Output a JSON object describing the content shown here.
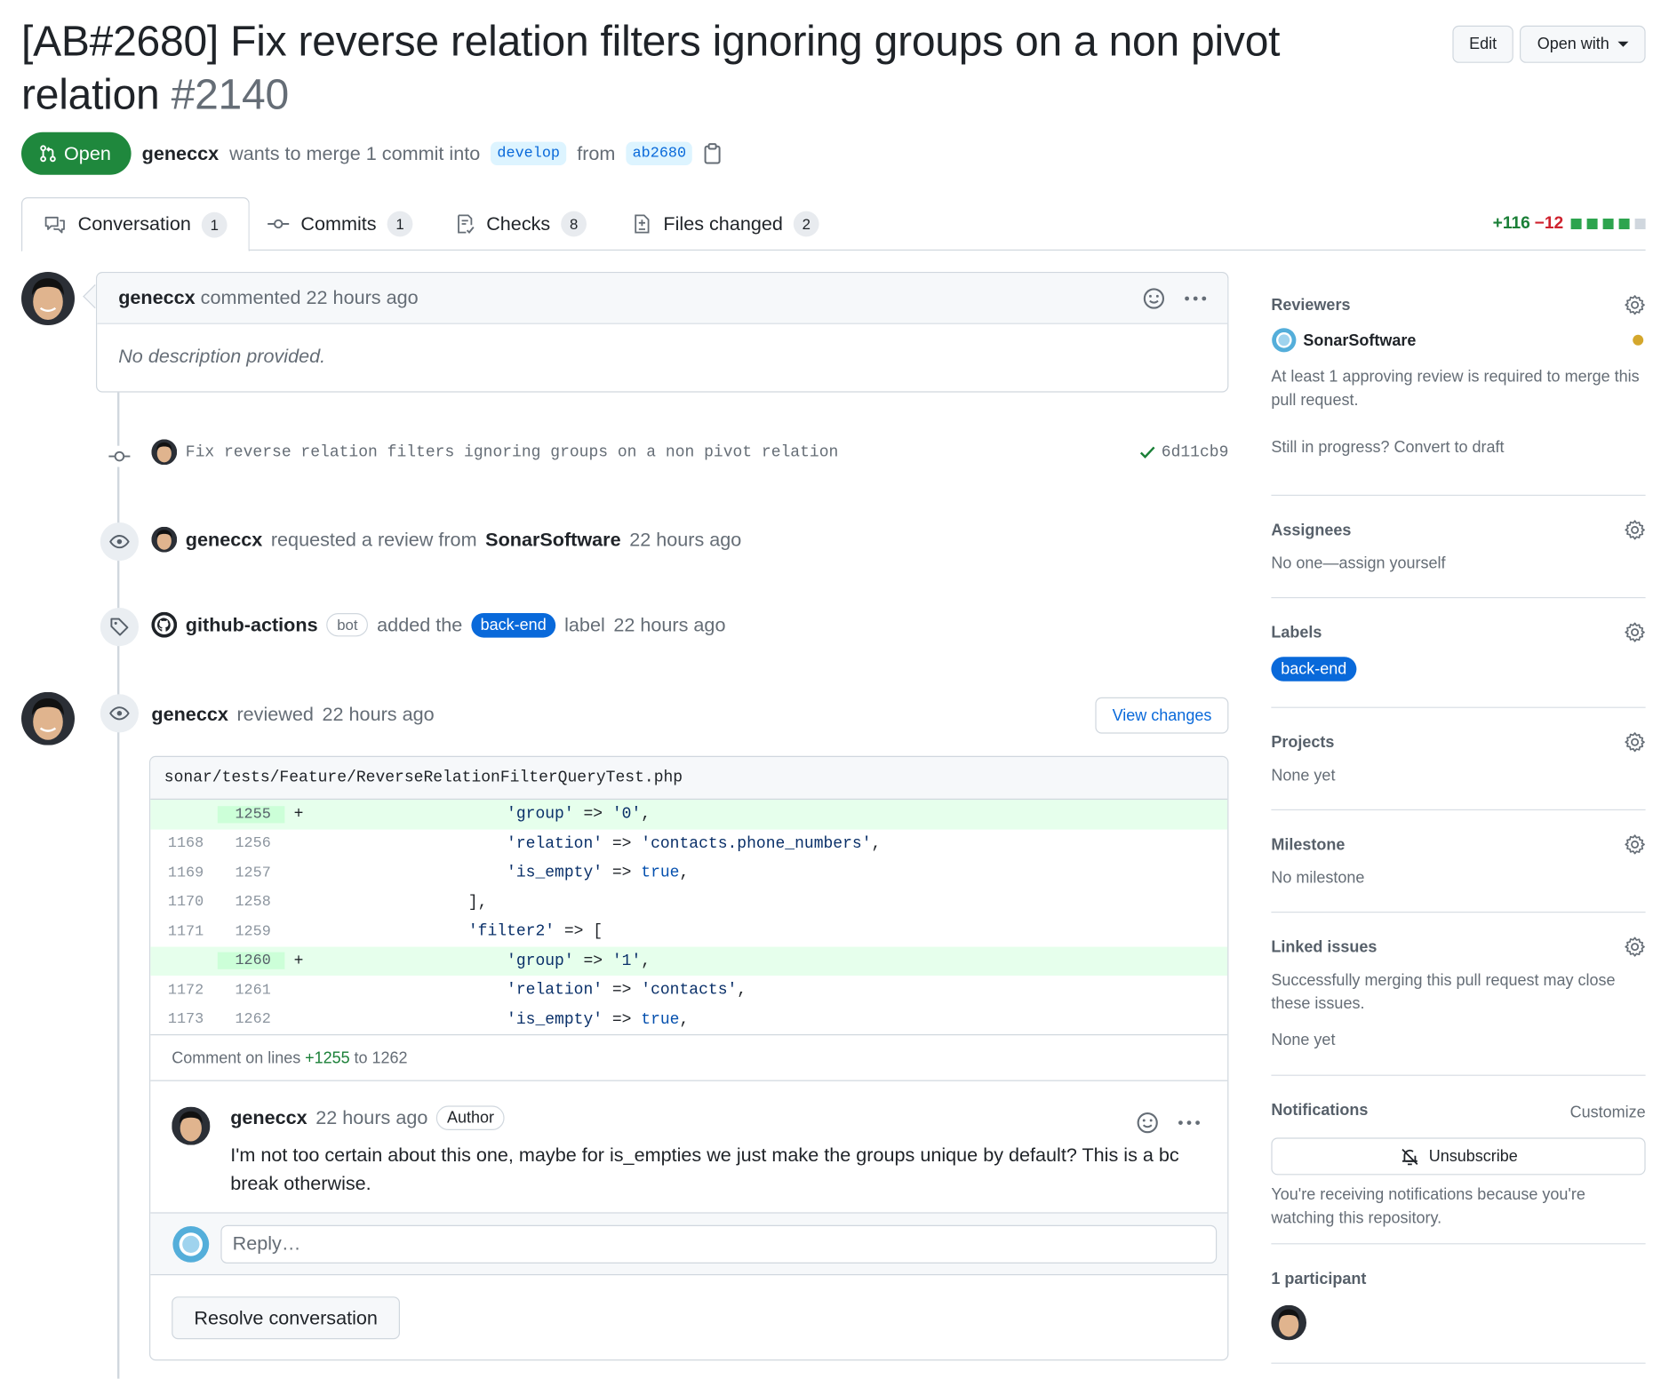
{
  "header": {
    "title": "[AB#2680] Fix reverse relation filters ignoring groups on a non pivot relation",
    "number": "#2140",
    "edit_label": "Edit",
    "open_with_label": "Open with"
  },
  "status": {
    "state_label": "Open",
    "author": "geneccx",
    "merge_text": "wants to merge 1 commit into",
    "base_branch": "develop",
    "from_text": "from",
    "head_branch": "ab2680"
  },
  "tabs": [
    {
      "label": "Conversation",
      "count": "1"
    },
    {
      "label": "Commits",
      "count": "1"
    },
    {
      "label": "Checks",
      "count": "8"
    },
    {
      "label": "Files changed",
      "count": "2"
    }
  ],
  "diffstat": {
    "additions": "+116",
    "deletions": "−12",
    "add_color": "#1a7f37",
    "del_color": "#cf222e"
  },
  "first_comment": {
    "author": "geneccx",
    "action": "commented",
    "time": "22 hours ago",
    "body": "No description provided."
  },
  "commit": {
    "message": "Fix reverse relation filters ignoring groups on a non pivot relation",
    "sha": "6d11cb9"
  },
  "review_request": {
    "actor": "geneccx",
    "text": "requested a review from",
    "reviewer": "SonarSoftware",
    "time": "22 hours ago"
  },
  "label_event": {
    "actor": "github-actions",
    "bot_label": "bot",
    "text": "added the",
    "label": "back-end",
    "label_word": "label",
    "time": "22 hours ago"
  },
  "review": {
    "author": "geneccx",
    "action": "reviewed",
    "time": "22 hours ago",
    "view_changes_label": "View changes",
    "file_path": "sonar/tests/Feature/ReverseRelationFilterQueryTest.php",
    "lines": [
      {
        "old": "",
        "new": "1255",
        "sign": "+",
        "type": "add",
        "indent": "                    ",
        "parts": [
          [
            "s",
            "'group'"
          ],
          [
            "p",
            " => "
          ],
          [
            "s",
            "'0'"
          ],
          [
            "p",
            ","
          ]
        ]
      },
      {
        "old": "1168",
        "new": "1256",
        "sign": "",
        "type": "ctx",
        "indent": "                    ",
        "parts": [
          [
            "s",
            "'relation'"
          ],
          [
            "p",
            " => "
          ],
          [
            "s",
            "'contacts.phone_numbers'"
          ],
          [
            "p",
            ","
          ]
        ]
      },
      {
        "old": "1169",
        "new": "1257",
        "sign": "",
        "type": "ctx",
        "indent": "                    ",
        "parts": [
          [
            "s",
            "'is_empty'"
          ],
          [
            "p",
            " => "
          ],
          [
            "k",
            "true"
          ],
          [
            "p",
            ","
          ]
        ]
      },
      {
        "old": "1170",
        "new": "1258",
        "sign": "",
        "type": "ctx",
        "indent": "                ",
        "parts": [
          [
            "p",
            "],"
          ]
        ]
      },
      {
        "old": "1171",
        "new": "1259",
        "sign": "",
        "type": "ctx",
        "indent": "                ",
        "parts": [
          [
            "s",
            "'filter2'"
          ],
          [
            "p",
            " => ["
          ]
        ]
      },
      {
        "old": "",
        "new": "1260",
        "sign": "+",
        "type": "add",
        "indent": "                    ",
        "parts": [
          [
            "s",
            "'group'"
          ],
          [
            "p",
            " => "
          ],
          [
            "s",
            "'1'"
          ],
          [
            "p",
            ","
          ]
        ]
      },
      {
        "old": "1172",
        "new": "1261",
        "sign": "",
        "type": "ctx",
        "indent": "                    ",
        "parts": [
          [
            "s",
            "'relation'"
          ],
          [
            "p",
            " => "
          ],
          [
            "s",
            "'contacts'"
          ],
          [
            "p",
            ","
          ]
        ]
      },
      {
        "old": "1173",
        "new": "1262",
        "sign": "",
        "type": "ctx",
        "indent": "                    ",
        "parts": [
          [
            "s",
            "'is_empty'"
          ],
          [
            "p",
            " => "
          ],
          [
            "k",
            "true"
          ],
          [
            "p",
            ","
          ]
        ]
      }
    ],
    "comment_on": "Comment on lines",
    "range_start": "+1255",
    "range_to": "to 1262",
    "reply_author": "geneccx",
    "reply_time": "22 hours ago",
    "reply_badge": "Author",
    "reply_body": "I'm not too certain about this one, maybe for is_empties we just make the groups unique by default? This is a bc break otherwise.",
    "reply_placeholder": "Reply…",
    "resolve_label": "Resolve conversation"
  },
  "sidebar": {
    "reviewers_title": "Reviewers",
    "reviewer_name": "SonarSoftware",
    "reviewer_status_color": "#d4a72c",
    "approval_text": "At least 1 approving review is required to merge this pull request.",
    "draft_text": "Still in progress? Convert to draft",
    "assignees_title": "Assignees",
    "assignees_text": "No one—assign yourself",
    "labels_title": "Labels",
    "label": "back-end",
    "projects_title": "Projects",
    "projects_text": "None yet",
    "milestone_title": "Milestone",
    "milestone_text": "No milestone",
    "linked_title": "Linked issues",
    "linked_text": "Successfully merging this pull request may close these issues.",
    "linked_none": "None yet",
    "notifications_title": "Notifications",
    "customize_label": "Customize",
    "unsubscribe_label": "Unsubscribe",
    "notif_text": "You're receiving notifications because you're watching this repository.",
    "participants_title": "1 participant"
  }
}
